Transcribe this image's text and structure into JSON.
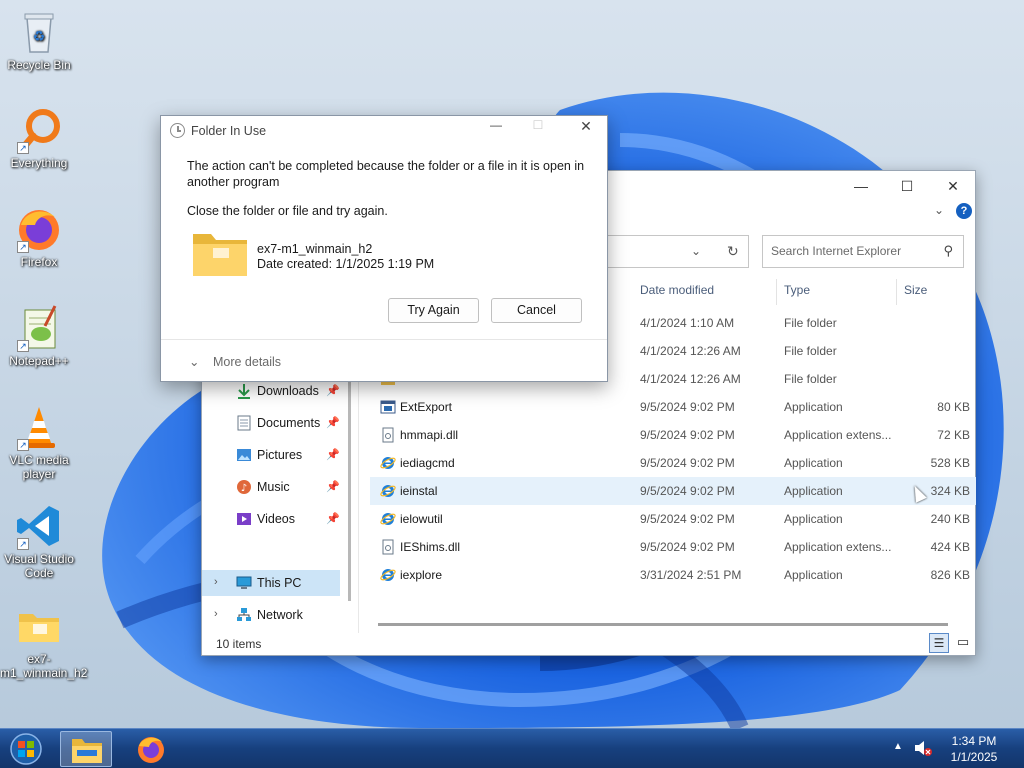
{
  "desktop": {
    "icons": [
      {
        "label": "Recycle Bin"
      },
      {
        "label": "Everything"
      },
      {
        "label": "Firefox"
      },
      {
        "label": "Notepad++"
      },
      {
        "label": "VLC media player"
      },
      {
        "label": "Visual Studio Code"
      },
      {
        "label": "ex7-m1_winmain_h2"
      }
    ]
  },
  "explorer": {
    "search_placeholder": "Search Internet Explorer",
    "columns": {
      "date": "Date modified",
      "type": "Type",
      "size": "Size"
    },
    "nav": {
      "downloads": "Downloads",
      "documents": "Documents",
      "pictures": "Pictures",
      "music": "Music",
      "videos": "Videos",
      "this_pc": "This PC",
      "network": "Network"
    },
    "status": "10 items",
    "files": [
      {
        "name": "",
        "date": "4/1/2024 1:10 AM",
        "type": "File folder",
        "size": ""
      },
      {
        "name": "",
        "date": "4/1/2024 12:26 AM",
        "type": "File folder",
        "size": ""
      },
      {
        "name": "",
        "date": "4/1/2024 12:26 AM",
        "type": "File folder",
        "size": ""
      },
      {
        "name": "ExtExport",
        "date": "9/5/2024 9:02 PM",
        "type": "Application",
        "size": "80 KB"
      },
      {
        "name": "hmmapi.dll",
        "date": "9/5/2024 9:02 PM",
        "type": "Application extens...",
        "size": "72 KB"
      },
      {
        "name": "iediagcmd",
        "date": "9/5/2024 9:02 PM",
        "type": "Application",
        "size": "528 KB"
      },
      {
        "name": "ieinstal",
        "date": "9/5/2024 9:02 PM",
        "type": "Application",
        "size": "324 KB"
      },
      {
        "name": "ielowutil",
        "date": "9/5/2024 9:02 PM",
        "type": "Application",
        "size": "240 KB"
      },
      {
        "name": "IEShims.dll",
        "date": "9/5/2024 9:02 PM",
        "type": "Application extens...",
        "size": "424 KB"
      },
      {
        "name": "iexplore",
        "date": "3/31/2024 2:51 PM",
        "type": "Application",
        "size": "826 KB"
      }
    ]
  },
  "dialog": {
    "title": "Folder In Use",
    "message": "The action can't be completed because the folder or a file in it is open in another program",
    "instruction": "Close the folder or file and try again.",
    "item_name": "ex7-m1_winmain_h2",
    "item_date": "Date created: 1/1/2025 1:19 PM",
    "try_again": "Try Again",
    "cancel": "Cancel",
    "more_details": "More details"
  },
  "taskbar": {
    "time": "1:34 PM",
    "date": "1/1/2025"
  }
}
